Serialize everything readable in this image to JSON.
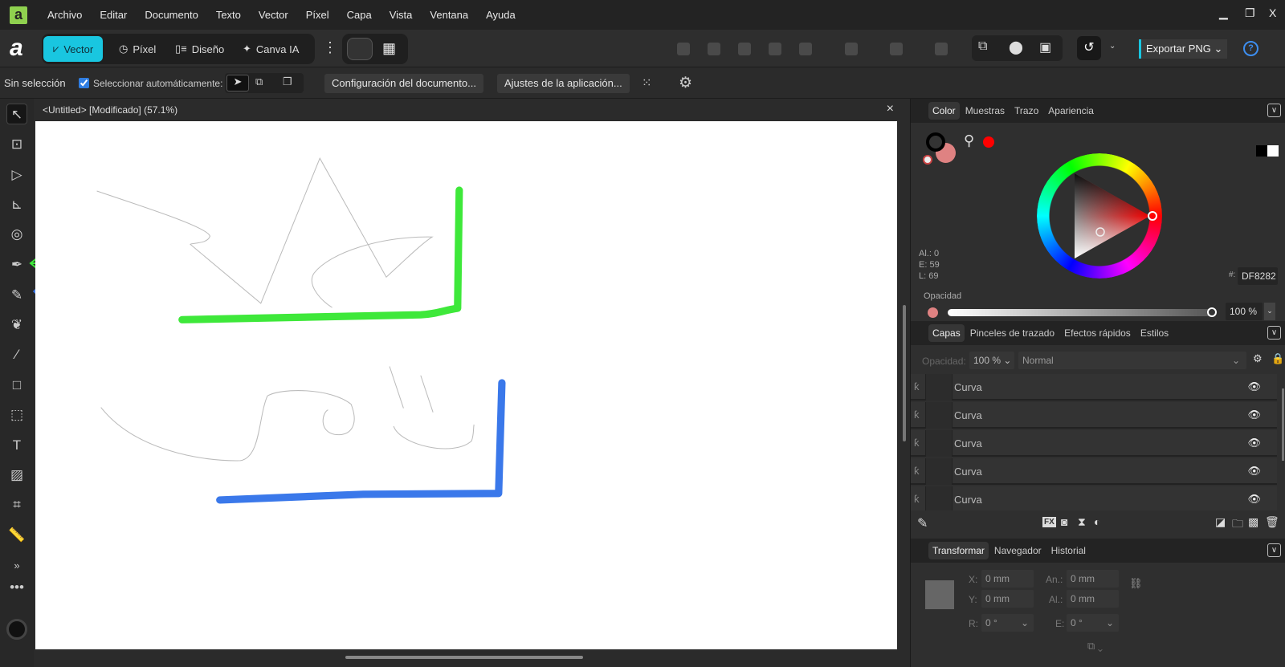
{
  "app": {
    "logo_letter": "a"
  },
  "menu": [
    "Archivo",
    "Editar",
    "Documento",
    "Texto",
    "Vector",
    "Píxel",
    "Capa",
    "Vista",
    "Ventana",
    "Ayuda"
  ],
  "window_controls": {
    "minimize": "▁",
    "restore": "❐",
    "close": "X"
  },
  "personas": [
    {
      "label": "Vector",
      "active": true
    },
    {
      "label": "Píxel"
    },
    {
      "label": "Diseño"
    },
    {
      "label": "Canva IA"
    }
  ],
  "export": {
    "label": "Exportar PNG"
  },
  "help": "?",
  "context": {
    "status": "Sin selección",
    "auto_select_label": "Seleccionar automáticamente:",
    "auto_select_checked": true,
    "doc_settings": "Configuración del documento...",
    "app_settings": "Ajustes de la aplicación..."
  },
  "document": {
    "title": "<Untitled> [Modificado] (57.1%)",
    "close": "×"
  },
  "color_panel": {
    "tabs": [
      "Color",
      "Muestras",
      "Trazo",
      "Apariencia"
    ],
    "al": "Al.: 0",
    "e": "E: 59",
    "l": "L: 69",
    "hex_label": "#:",
    "hex": "DF8282",
    "opacity_label": "Opacidad",
    "opacity": "100 %",
    "opacity_value": 100,
    "fill_color": "#DF8282"
  },
  "layers_panel": {
    "tabs": [
      "Capas",
      "Pinceles de trazado",
      "Efectos rápidos",
      "Estilos"
    ],
    "opacity_label": "Opacidad:",
    "opacity": "100 %",
    "blend": "Normal",
    "layers": [
      "Curva",
      "Curva",
      "Curva",
      "Curva",
      "Curva"
    ],
    "fx": "FX"
  },
  "transform_panel": {
    "tabs": [
      "Transformar",
      "Navegador",
      "Historial"
    ],
    "x_label": "X:",
    "x": "0 mm",
    "y_label": "Y:",
    "y": "0 mm",
    "w_label": "An.:",
    "w": "0 mm",
    "h_label": "Al.:",
    "h": "0 mm",
    "r_label": "R:",
    "r": "0 °",
    "s_label": "E:",
    "s": "0 °"
  },
  "colors": {
    "accent": "#19c6e0",
    "green_stroke": "#3ee83a",
    "blue_stroke": "#3a78ea"
  },
  "more_tools": "»"
}
